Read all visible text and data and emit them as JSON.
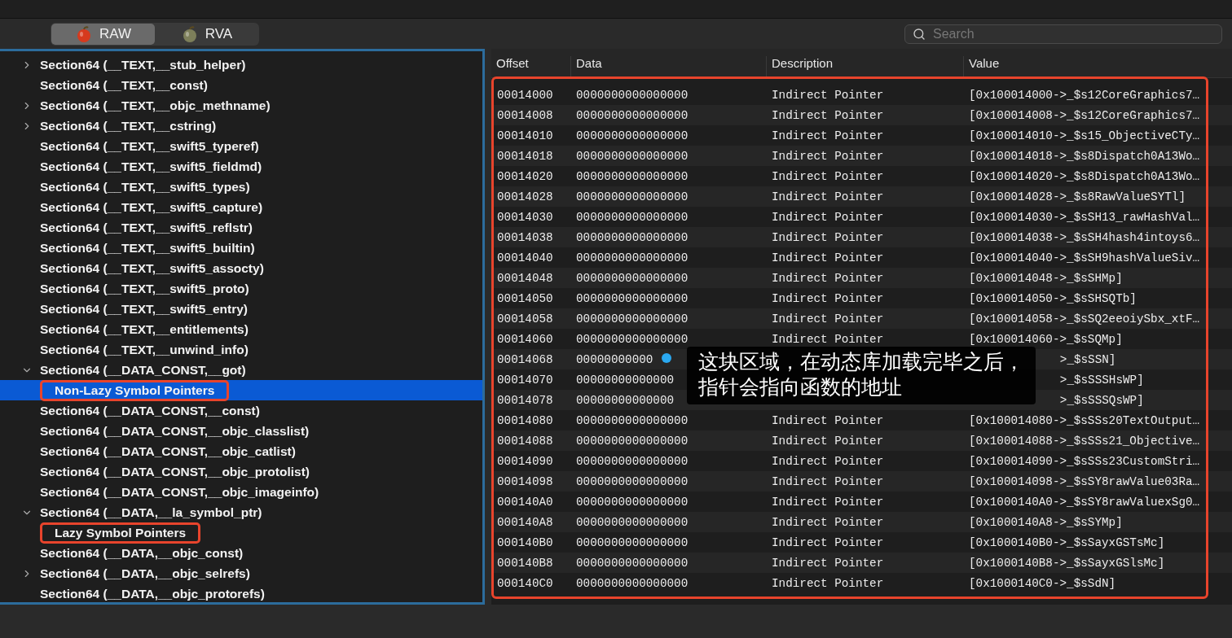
{
  "toolbar": {
    "modes": [
      {
        "label": "RAW",
        "selected": true,
        "kind": "red"
      },
      {
        "label": "RVA",
        "selected": false,
        "kind": "olive"
      }
    ],
    "search": {
      "placeholder": "Search"
    }
  },
  "sidebar": {
    "items": [
      {
        "label": "Section64 (__TEXT,__stub_helper)",
        "kind": "group",
        "expanded": false,
        "selected": false
      },
      {
        "label": "Section64 (__TEXT,__const)",
        "kind": "leaf",
        "selected": false
      },
      {
        "label": "Section64 (__TEXT,__objc_methname)",
        "kind": "group",
        "expanded": false,
        "selected": false
      },
      {
        "label": "Section64 (__TEXT,__cstring)",
        "kind": "group",
        "expanded": false,
        "selected": false
      },
      {
        "label": "Section64 (__TEXT,__swift5_typeref)",
        "kind": "leaf",
        "selected": false
      },
      {
        "label": "Section64 (__TEXT,__swift5_fieldmd)",
        "kind": "leaf",
        "selected": false
      },
      {
        "label": "Section64 (__TEXT,__swift5_types)",
        "kind": "leaf",
        "selected": false
      },
      {
        "label": "Section64 (__TEXT,__swift5_capture)",
        "kind": "leaf",
        "selected": false
      },
      {
        "label": "Section64 (__TEXT,__swift5_reflstr)",
        "kind": "leaf",
        "selected": false
      },
      {
        "label": "Section64 (__TEXT,__swift5_builtin)",
        "kind": "leaf",
        "selected": false
      },
      {
        "label": "Section64 (__TEXT,__swift5_assocty)",
        "kind": "leaf",
        "selected": false
      },
      {
        "label": "Section64 (__TEXT,__swift5_proto)",
        "kind": "leaf",
        "selected": false
      },
      {
        "label": "Section64 (__TEXT,__swift5_entry)",
        "kind": "leaf",
        "selected": false
      },
      {
        "label": "Section64 (__TEXT,__entitlements)",
        "kind": "leaf",
        "selected": false
      },
      {
        "label": "Section64 (__TEXT,__unwind_info)",
        "kind": "leaf",
        "selected": false
      },
      {
        "label": "Section64 (__DATA_CONST,__got)",
        "kind": "group",
        "expanded": true,
        "selected": false,
        "children": [
          {
            "label": "Non-Lazy Symbol Pointers",
            "kind": "leaf",
            "selected": true,
            "highlighted": true
          }
        ]
      },
      {
        "label": "Section64 (__DATA_CONST,__const)",
        "kind": "leaf",
        "selected": false
      },
      {
        "label": "Section64 (__DATA_CONST,__objc_classlist)",
        "kind": "leaf",
        "selected": false
      },
      {
        "label": "Section64 (__DATA_CONST,__objc_catlist)",
        "kind": "leaf",
        "selected": false
      },
      {
        "label": "Section64 (__DATA_CONST,__objc_protolist)",
        "kind": "leaf",
        "selected": false
      },
      {
        "label": "Section64 (__DATA_CONST,__objc_imageinfo)",
        "kind": "leaf",
        "selected": false
      },
      {
        "label": "Section64 (__DATA,__la_symbol_ptr)",
        "kind": "group",
        "expanded": true,
        "selected": false,
        "children": [
          {
            "label": "Lazy Symbol Pointers",
            "kind": "leaf",
            "selected": false,
            "highlighted": true
          }
        ]
      },
      {
        "label": "Section64 (__DATA,__objc_const)",
        "kind": "leaf",
        "selected": false
      },
      {
        "label": "Section64 (__DATA,__objc_selrefs)",
        "kind": "group",
        "expanded": false,
        "selected": false
      },
      {
        "label": "Section64 (__DATA,__objc_protorefs)",
        "kind": "leaf",
        "selected": false
      }
    ]
  },
  "table": {
    "highlighted": true,
    "columns": [
      "Offset",
      "Data",
      "Description",
      "Value"
    ],
    "rows": [
      [
        "00014000",
        "0000000000000000",
        "Indirect Pointer",
        "[0x100014000->_$s12CoreGraphics7…"
      ],
      [
        "00014008",
        "0000000000000000",
        "Indirect Pointer",
        "[0x100014008->_$s12CoreGraphics7…"
      ],
      [
        "00014010",
        "0000000000000000",
        "Indirect Pointer",
        "[0x100014010->_$s15_ObjectiveCTy…"
      ],
      [
        "00014018",
        "0000000000000000",
        "Indirect Pointer",
        "[0x100014018->_$s8Dispatch0A13Wo…"
      ],
      [
        "00014020",
        "0000000000000000",
        "Indirect Pointer",
        "[0x100014020->_$s8Dispatch0A13Wo…"
      ],
      [
        "00014028",
        "0000000000000000",
        "Indirect Pointer",
        "[0x100014028->_$s8RawValueSYTl]"
      ],
      [
        "00014030",
        "0000000000000000",
        "Indirect Pointer",
        "[0x100014030->_$sSH13_rawHashVal…"
      ],
      [
        "00014038",
        "0000000000000000",
        "Indirect Pointer",
        "[0x100014038->_$sSH4hash4intoys6…"
      ],
      [
        "00014040",
        "0000000000000000",
        "Indirect Pointer",
        "[0x100014040->_$sSH9hashValueSiv…"
      ],
      [
        "00014048",
        "0000000000000000",
        "Indirect Pointer",
        "[0x100014048->_$sSHMp]"
      ],
      [
        "00014050",
        "0000000000000000",
        "Indirect Pointer",
        "[0x100014050->_$sSHSQTb]"
      ],
      [
        "00014058",
        "0000000000000000",
        "Indirect Pointer",
        "[0x100014058->_$sSQ2eeoiySbx_xtF…"
      ],
      [
        "00014060",
        "0000000000000000",
        "Indirect Pointer",
        "[0x100014060->_$sSQMp]"
      ],
      [
        "00014068",
        "00000000000",
        null,
        ">_$sSSN]"
      ],
      [
        "00014070",
        "00000000000000",
        null,
        ">_$sSSSHsWP]"
      ],
      [
        "00014078",
        "00000000000000",
        null,
        ">_$sSSSQsWP]"
      ],
      [
        "00014080",
        "0000000000000000",
        "Indirect Pointer",
        "[0x100014080->_$sSSs20TextOutput…"
      ],
      [
        "00014088",
        "0000000000000000",
        "Indirect Pointer",
        "[0x100014088->_$sSSs21_Objective…"
      ],
      [
        "00014090",
        "0000000000000000",
        "Indirect Pointer",
        "[0x100014090->_$sSSs23CustomStri…"
      ],
      [
        "00014098",
        "0000000000000000",
        "Indirect Pointer",
        "[0x100014098->_$sSY8rawValue03Ra…"
      ],
      [
        "000140A0",
        "0000000000000000",
        "Indirect Pointer",
        "[0x1000140A0->_$sSY8rawValuexSg0…"
      ],
      [
        "000140A8",
        "0000000000000000",
        "Indirect Pointer",
        "[0x1000140A8->_$sSYMp]"
      ],
      [
        "000140B0",
        "0000000000000000",
        "Indirect Pointer",
        "[0x1000140B0->_$sSayxGSTsMc]"
      ],
      [
        "000140B8",
        "0000000000000000",
        "Indirect Pointer",
        "[0x1000140B8->_$sSayxGSlsMc]"
      ],
      [
        "000140C0",
        "0000000000000000",
        "Indirect Pointer",
        "[0x1000140C0->_$sSdN]"
      ]
    ]
  },
  "caption": {
    "lines": [
      "这块区域，在动态库加载完毕之后，",
      "指针会指向函数的地址"
    ]
  }
}
